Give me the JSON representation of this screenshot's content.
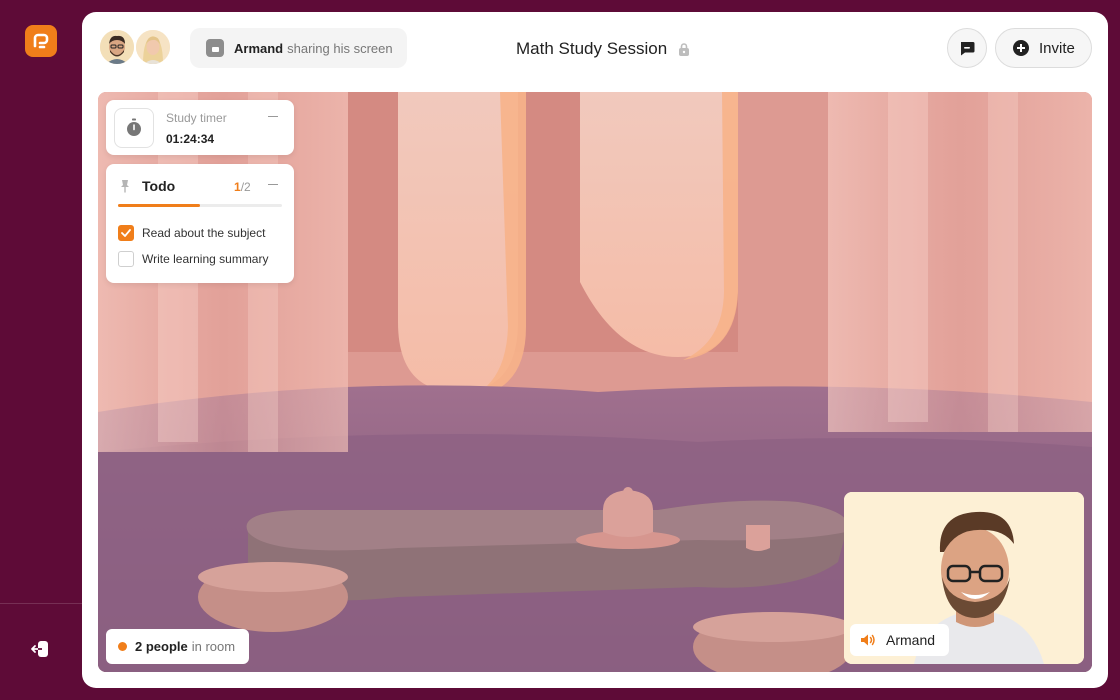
{
  "sidebar": {
    "logo_icon": "brand-logo-icon",
    "exit_icon": "leave-room-icon"
  },
  "header": {
    "share_status": {
      "user": "Armand",
      "text": "sharing his screen"
    },
    "title": "Math Study Session",
    "lock_icon": "lock-icon",
    "chat_icon": "chat-icon",
    "invite_label": "Invite"
  },
  "timer": {
    "label": "Study timer",
    "value": "01:24:34"
  },
  "todo": {
    "title": "Todo",
    "done": "1",
    "total": "/2",
    "progress": 0.5,
    "items": [
      {
        "label": "Read about the subject",
        "checked": true
      },
      {
        "label": "Write learning summary",
        "checked": false
      }
    ]
  },
  "room": {
    "count": "2 people",
    "suffix": "in room"
  },
  "video": {
    "speaker": "Armand"
  },
  "colors": {
    "accent": "#f07e1a",
    "sidebar": "#5e0b37"
  }
}
